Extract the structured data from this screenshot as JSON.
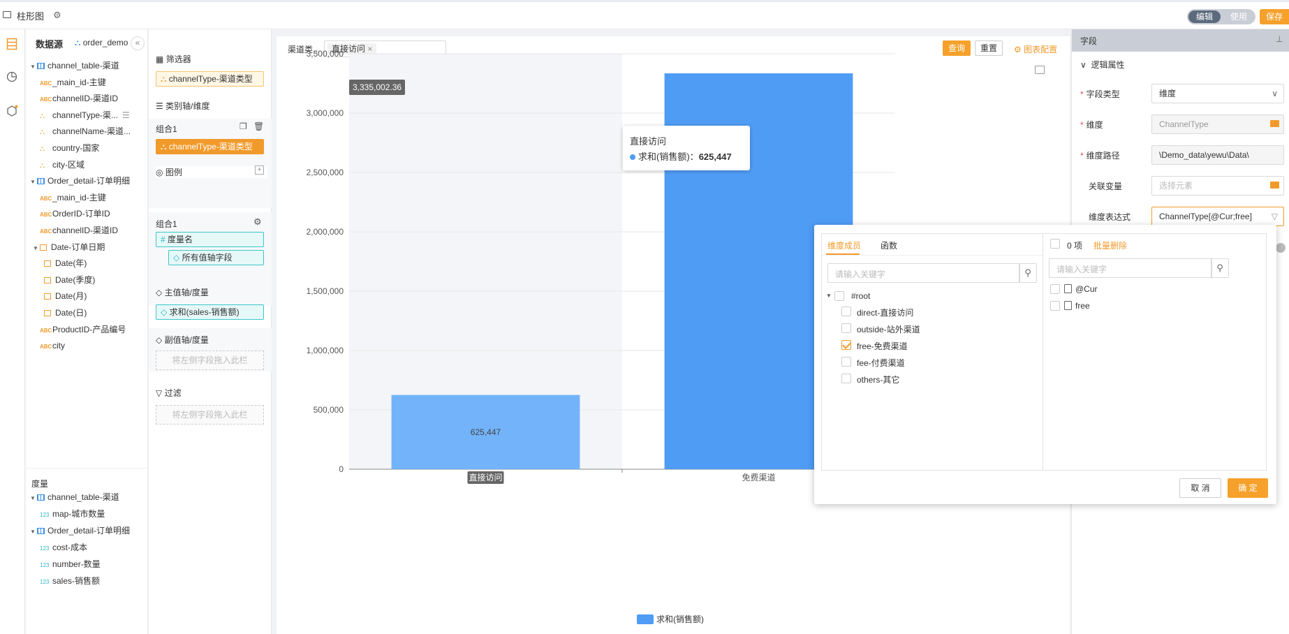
{
  "topbar": {
    "title": "柱形图",
    "mode_edit": "编辑",
    "mode_use": "使用",
    "save": "保存"
  },
  "datapanel": {
    "title": "数据源",
    "datasource": "order_demo",
    "dimension_tree": [
      {
        "kind": "table",
        "label": "channel_table-渠道"
      },
      {
        "kind": "text",
        "label": "_main_id-主键"
      },
      {
        "kind": "text",
        "label": "channelID-渠道ID"
      },
      {
        "kind": "dim",
        "label": "channelType-渠..."
      },
      {
        "kind": "dim",
        "label": "channelName-渠道..."
      },
      {
        "kind": "dim",
        "label": "country-国家"
      },
      {
        "kind": "dim",
        "label": "city-区域"
      },
      {
        "kind": "table",
        "label": "Order_detail-订单明细"
      },
      {
        "kind": "text",
        "label": "_main_id-主键"
      },
      {
        "kind": "text",
        "label": "OrderID-订单ID"
      },
      {
        "kind": "text",
        "label": "channelID-渠道ID"
      },
      {
        "kind": "datefolder",
        "label": "Date-订单日期"
      },
      {
        "kind": "date",
        "label": "Date(年)"
      },
      {
        "kind": "date",
        "label": "Date(季度)"
      },
      {
        "kind": "date",
        "label": "Date(月)"
      },
      {
        "kind": "date",
        "label": "Date(日)"
      },
      {
        "kind": "text",
        "label": "ProductID-产品编号"
      },
      {
        "kind": "text",
        "label": "city"
      }
    ],
    "measure_title": "度量",
    "measure_tree": [
      {
        "kind": "table",
        "label": "channel_table-渠道"
      },
      {
        "kind": "num",
        "label": "map-城市数量"
      },
      {
        "kind": "table",
        "label": "Order_detail-订单明细"
      },
      {
        "kind": "num",
        "label": "cost-成本"
      },
      {
        "kind": "num",
        "label": "number-数量"
      },
      {
        "kind": "num",
        "label": "sales-销售额"
      }
    ],
    "text_tag": "ABC",
    "num_tag": "123"
  },
  "shelf": {
    "filter_title": "筛选器",
    "filter_pill": "channelType-渠道类型",
    "category_title": "类别轴/维度",
    "group1": "组合1",
    "category_pill": "channelType-渠道类型",
    "legend_title": "图例",
    "legend_group": "组合1",
    "legend_pill1": "度量名",
    "legend_pill2": "所有值轴字段",
    "main_axis_title": "主值轴/度量",
    "main_axis_pill": "求和(sales-销售额)",
    "sub_axis_title": "副值轴/度量",
    "drop_hint": "将左侧字段拖入此栏",
    "filter2_title": "过滤",
    "drop_hint2": "将左侧字段拖入此栏"
  },
  "chart_header": {
    "filter_label": "渠道类...",
    "chip": "直接访问",
    "query": "查询",
    "reset": "重置",
    "config": "图表配置"
  },
  "chart_data": {
    "type": "bar",
    "categories": [
      "直接访问",
      "免费渠道"
    ],
    "series": [
      {
        "name": "求和(销售额)",
        "values": [
          625447,
          3335002.36
        ]
      }
    ],
    "ylim": [
      0,
      3500000
    ],
    "yticks": [
      "0",
      "500,000",
      "1,000,000",
      "1,500,000",
      "2,000,000",
      "2,500,000",
      "3,000,000",
      "3,500,000"
    ],
    "data_labels": [
      "625,447"
    ],
    "hover_value_label": "3,335,002.36",
    "tooltip": {
      "title": "直接访问",
      "series": "求和(销售额)",
      "value": "625,447"
    },
    "legend": "求和(销售额)",
    "colors": {
      "bar1": "#73b3fa",
      "bar2": "#4f9cf5",
      "highlight": "#f4f5f8"
    }
  },
  "fieldpanel": {
    "title": "字段",
    "section": "逻辑属性",
    "field_type_label": "字段类型",
    "field_type_value": "维度",
    "dimension_label": "维度",
    "dimension_value": "ChannelType",
    "path_label": "维度路径",
    "path_value": "\\Demo_data\\yewu\\Data\\",
    "var_label": "关联变量",
    "var_placeholder": "选择元素",
    "expr_label": "维度表达式",
    "expr_value": "ChannelType[@Cur;free]"
  },
  "popover": {
    "tab_members": "维度成员",
    "tab_functions": "函数",
    "search_placeholder": "请输入关键字",
    "root": "#root",
    "members": [
      {
        "label": "direct-直接访问",
        "checked": false
      },
      {
        "label": "outside-站外渠道",
        "checked": false
      },
      {
        "label": "free-免费渠道",
        "checked": true
      },
      {
        "label": "fee-付费渠道",
        "checked": false
      },
      {
        "label": "others-其它",
        "checked": false
      }
    ],
    "count": "0 项",
    "batch_delete": "批量删除",
    "right_search_placeholder": "请输入关键字",
    "selected": [
      "@Cur",
      "free"
    ],
    "cancel": "取 消",
    "ok": "确 定"
  }
}
